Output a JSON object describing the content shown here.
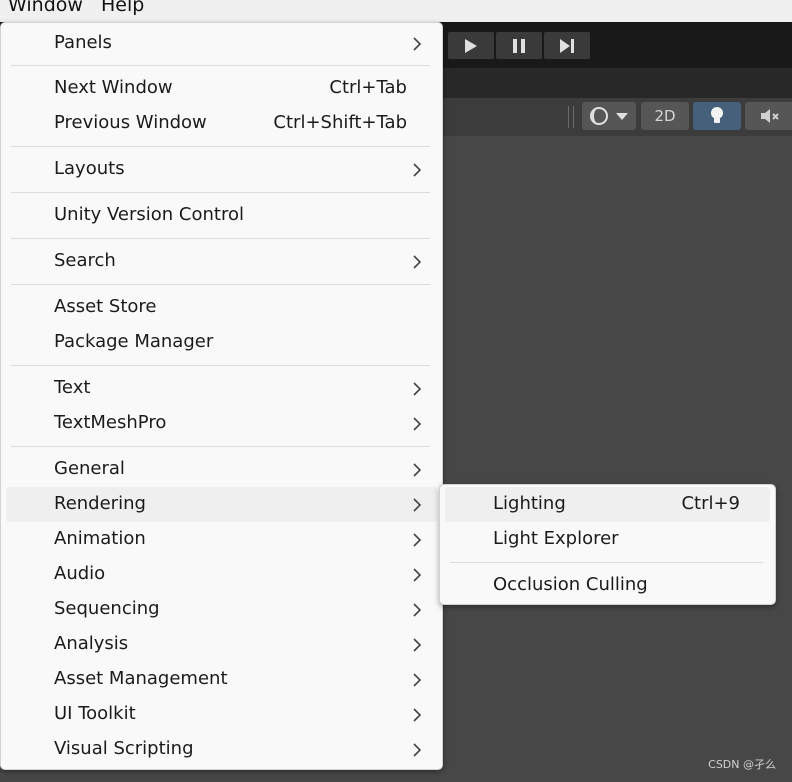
{
  "menubar": {
    "window": "Window",
    "help": "Help"
  },
  "scene_toolbar": {
    "mode_2d": "2D"
  },
  "window_menu": {
    "items": [
      {
        "label": "Panels",
        "submenu": true
      },
      {
        "label": "Next Window",
        "shortcut": "Ctrl+Tab"
      },
      {
        "label": "Previous Window",
        "shortcut": "Ctrl+Shift+Tab"
      },
      {
        "label": "Layouts",
        "submenu": true
      },
      {
        "label": "Unity Version Control"
      },
      {
        "label": "Search",
        "submenu": true
      },
      {
        "label": "Asset Store"
      },
      {
        "label": "Package Manager"
      },
      {
        "label": "Text",
        "submenu": true
      },
      {
        "label": "TextMeshPro",
        "submenu": true
      },
      {
        "label": "General",
        "submenu": true
      },
      {
        "label": "Rendering",
        "submenu": true,
        "highlighted": true
      },
      {
        "label": "Animation",
        "submenu": true
      },
      {
        "label": "Audio",
        "submenu": true
      },
      {
        "label": "Sequencing",
        "submenu": true
      },
      {
        "label": "Analysis",
        "submenu": true
      },
      {
        "label": "Asset Management",
        "submenu": true
      },
      {
        "label": "UI Toolkit",
        "submenu": true
      },
      {
        "label": "Visual Scripting",
        "submenu": true
      }
    ]
  },
  "rendering_submenu": {
    "items": [
      {
        "label": "Lighting",
        "shortcut": "Ctrl+9",
        "highlighted": true
      },
      {
        "label": "Light Explorer"
      },
      {
        "label": "Occlusion Culling"
      }
    ]
  },
  "watermark": "CSDN @孑么"
}
